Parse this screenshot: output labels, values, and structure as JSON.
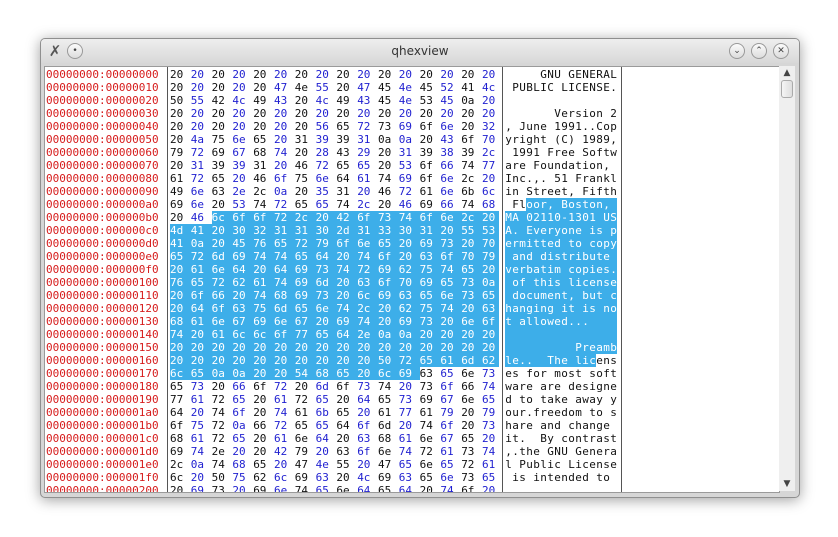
{
  "window": {
    "title": "qhexview",
    "app_icon_glyph": "✗",
    "menu_glyph": "•",
    "buttons": {
      "minimize": "⌄",
      "maximize": "⌃",
      "close": "✕"
    }
  },
  "colors": {
    "offset": "#d61c1c",
    "hex_even": "#111111",
    "hex_odd": "#1f1fd0",
    "selection": "#3daee9"
  },
  "scrollbar": {
    "up": "▲",
    "down": "▼"
  },
  "selection": {
    "start": 178,
    "end": 379
  },
  "hexdump": {
    "offsets": [
      "00000000:00000000",
      "00000000:00000010",
      "00000000:00000020",
      "00000000:00000030",
      "00000000:00000040",
      "00000000:00000050",
      "00000000:00000060",
      "00000000:00000070",
      "00000000:00000080",
      "00000000:00000090",
      "00000000:000000a0",
      "00000000:000000b0",
      "00000000:000000c0",
      "00000000:000000d0",
      "00000000:000000e0",
      "00000000:000000f0",
      "00000000:00000100",
      "00000000:00000110",
      "00000000:00000120",
      "00000000:00000130",
      "00000000:00000140",
      "00000000:00000150",
      "00000000:00000160",
      "00000000:00000170",
      "00000000:00000180",
      "00000000:00000190",
      "00000000:000001a0",
      "00000000:000001b0",
      "00000000:000001c0",
      "00000000:000001d0",
      "00000000:000001e0",
      "00000000:000001f0",
      "00000000:00000200"
    ],
    "hex": [
      "20 20 20 20 20 20 20 20 20 20 20 20 20 20 20 20",
      "20 20 20 20 20 47 4e 55 20 47 45 4e 45 52 41 4c",
      "50 55 42 4c 49 43 20 4c 49 43 45 4e 53 45 0a 20",
      "20 20 20 20 20 20 20 20 20 20 20 20 20 20 20 20",
      "20 20 20 20 20 20 20 56 65 72 73 69 6f 6e 20 32",
      "20 4a 75 6e 65 20 31 39 39 31 0a 0a 20 43 6f 70",
      "79 72 69 67 68 74 20 28 43 29 20 31 39 38 39 2c",
      "20 31 39 39 31 20 46 72 65 65 20 53 6f 66 74 77",
      "61 72 65 20 46 6f 75 6e 64 61 74 69 6f 6e 2c 20",
      "49 6e 63 2e 2c 0a 20 35 31 20 46 72 61 6e 6b 6c",
      "69 6e 20 53 74 72 65 65 74 2c 20 46 69 66 74 68",
      "20 46 6c 6f 6f 72 2c 20 42 6f 73 74 6f 6e 2c 20",
      "4d 41 20 30 32 31 31 30 2d 31 33 30 31 20 55 53",
      "41 0a 20 45 76 65 72 79 6f 6e 65 20 69 73 20 70",
      "65 72 6d 69 74 74 65 64 20 74 6f 20 63 6f 70 79",
      "20 61 6e 64 20 64 69 73 74 72 69 62 75 74 65 20",
      "76 65 72 62 61 74 69 6d 20 63 6f 70 69 65 73 0a",
      "20 6f 66 20 74 68 69 73 20 6c 69 63 65 6e 73 65",
      "20 64 6f 63 75 6d 65 6e 74 2c 20 62 75 74 20 63",
      "68 61 6e 67 69 6e 67 20 69 74 20 69 73 20 6e 6f",
      "74 20 61 6c 6c 6f 77 65 64 2e 0a 0a 20 20 20 20",
      "20 20 20 20 20 20 20 20 20 20 20 20 20 20 20 20",
      "20 20 20 20 20 20 20 20 20 20 50 72 65 61 6d 62",
      "6c 65 0a 0a 20 20 54 68 65 20 6c 69 63 65 6e 73",
      "65 73 20 66 6f 72 20 6d 6f 73 74 20 73 6f 66 74",
      "77 61 72 65 20 61 72 65 20 64 65 73 69 67 6e 65",
      "64 20 74 6f 20 74 61 6b 65 20 61 77 61 79 20 79",
      "6f 75 72 0a 66 72 65 65 64 6f 6d 20 74 6f 20 73",
      "68 61 72 65 20 61 6e 64 20 63 68 61 6e 67 65 20",
      "69 74 2e 20 20 42 79 20 63 6f 6e 74 72 61 73 74",
      "2c 0a 74 68 65 20 47 4e 55 20 47 65 6e 65 72 61",
      "6c 20 50 75 62 6c 69 63 20 4c 69 63 65 6e 73 65",
      "20 69 73 20 69 6e 74 65 6e 64 65 64 20 74 6f 20"
    ],
    "ascii": [
      "     GNU GENERAL",
      " PUBLIC LICENSE.",
      "                ",
      "       Version 2",
      ", June 1991..Cop",
      "yright (C) 1989,",
      " 1991 Free Softw",
      "are Foundation, ",
      "Inc.,. 51 Frankl",
      "in Street, Fifth",
      " Floor, Boston, ",
      "MA 02110-1301 US",
      "A. Everyone is p",
      "ermitted to copy",
      " and distribute ",
      "verbatim copies.",
      " of this license",
      " document, but c",
      "hanging it is no",
      "t allowed...    ",
      "                ",
      "          Preamb",
      "le..  The licens",
      "es for most soft",
      "ware are designe",
      "d to take away y",
      "our.freedom to s",
      "hare and change ",
      "it.  By contrast",
      ",.the GNU Genera",
      "l Public License",
      " is intended to "
    ]
  }
}
